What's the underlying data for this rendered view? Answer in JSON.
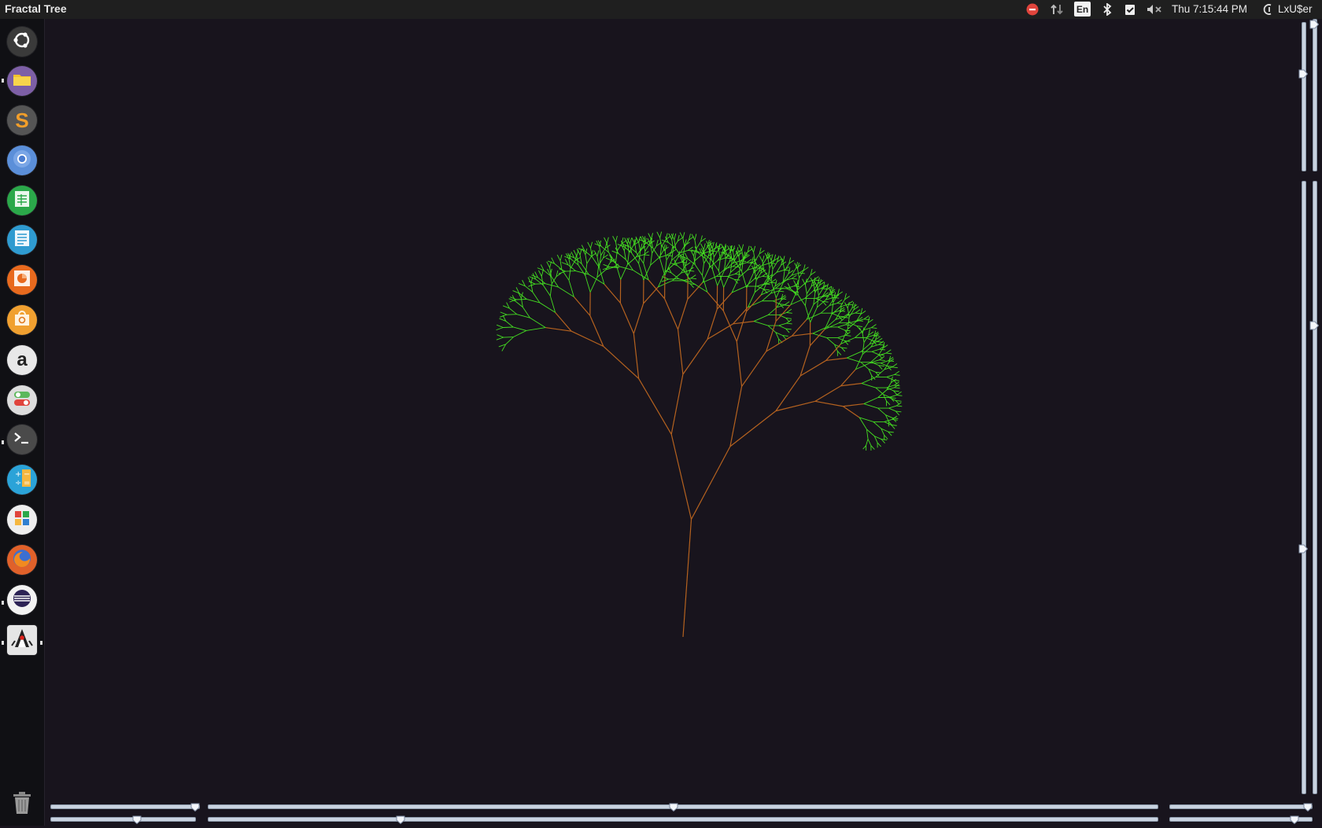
{
  "window": {
    "title": "Fractal Tree"
  },
  "top_panel": {
    "indicators": [
      "stop-icon",
      "network-arrows-icon",
      "bluetooth-icon",
      "checkbox-indicator-icon",
      "volume-muted-icon",
      "session-icon"
    ],
    "language": "En",
    "clock": "Thu  7:15:44 PM",
    "user": "LxU$er"
  },
  "launcher": {
    "items": [
      {
        "name": "ubuntu-dash",
        "icon": "ubuntu-logo-icon",
        "color": "#3a3a3a"
      },
      {
        "name": "files",
        "icon": "folder-icon",
        "color": "#7d5fa6"
      },
      {
        "name": "sublime-text",
        "icon": "sublime-s-icon",
        "color": "#555555"
      },
      {
        "name": "chromium",
        "icon": "chromium-icon",
        "color": "#5b8fd9"
      },
      {
        "name": "spreadsheet",
        "icon": "spreadsheet-icon",
        "color": "#2ba84a"
      },
      {
        "name": "document",
        "icon": "document-icon",
        "color": "#2f9bd0"
      },
      {
        "name": "presentation",
        "icon": "presentation-icon",
        "color": "#e86a1e"
      },
      {
        "name": "software-center",
        "icon": "shopping-bag-icon",
        "color": "#f0a030"
      },
      {
        "name": "amazon",
        "icon": "amazon-a-icon",
        "color": "#e8e8e8"
      },
      {
        "name": "settings",
        "icon": "toggle-switches-icon",
        "color": "#dddddd"
      },
      {
        "name": "terminal",
        "icon": "terminal-icon",
        "color": "#4a4a4a"
      },
      {
        "name": "calculator",
        "icon": "calculator-icon",
        "color": "#2ba3d8"
      },
      {
        "name": "apps-grid",
        "icon": "apps-grid-icon",
        "color": "#eeeeee"
      },
      {
        "name": "firefox",
        "icon": "firefox-icon",
        "color": "#e0612a"
      },
      {
        "name": "eclipse",
        "icon": "eclipse-icon",
        "color": "#f2f2f2"
      },
      {
        "name": "java-app",
        "icon": "java-duke-icon",
        "color": "#e5e5e5"
      }
    ],
    "trash": "trash-icon"
  },
  "sliders": {
    "horizontal": [
      {
        "name": "slider-a1",
        "fraction": 1.0
      },
      {
        "name": "slider-a2",
        "fraction": 0.6
      },
      {
        "name": "slider-b1",
        "fraction": 0.49
      },
      {
        "name": "slider-b2",
        "fraction": 0.2
      },
      {
        "name": "slider-c1",
        "fraction": 1.0
      },
      {
        "name": "slider-c2",
        "fraction": 0.9
      }
    ],
    "vertical": [
      {
        "name": "slider-v1",
        "fraction": 0.33
      },
      {
        "name": "slider-v2",
        "fraction": 0.0
      },
      {
        "name": "slider-v3",
        "fraction": 0.6
      },
      {
        "name": "slider-v4",
        "fraction": 0.23
      }
    ]
  },
  "colors": {
    "background": "#18141d",
    "trunk": "#b5621f",
    "leaves": "#44dd22"
  }
}
